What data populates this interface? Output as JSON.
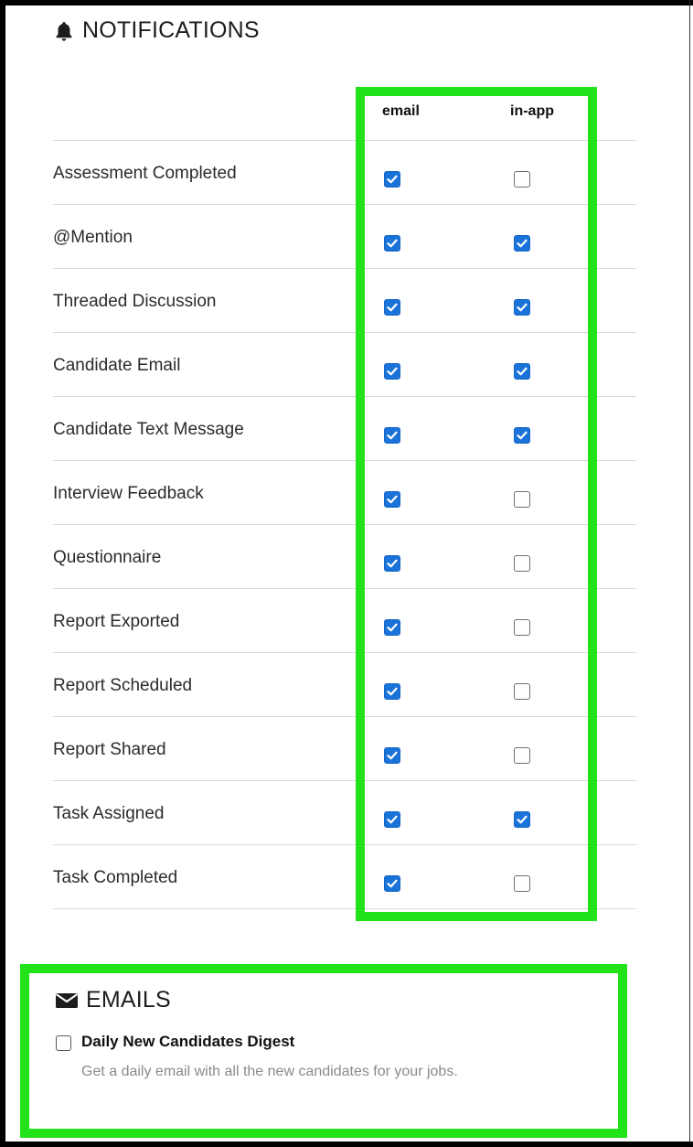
{
  "notifications": {
    "title": "NOTIFICATIONS",
    "icon": "bell-icon",
    "columns": [
      "email",
      "in-app"
    ],
    "rows": [
      {
        "label": "Assessment Completed",
        "email": true,
        "in_app": false
      },
      {
        "label": "@Mention",
        "email": true,
        "in_app": true
      },
      {
        "label": "Threaded Discussion",
        "email": true,
        "in_app": true
      },
      {
        "label": "Candidate Email",
        "email": true,
        "in_app": true
      },
      {
        "label": "Candidate Text Message",
        "email": true,
        "in_app": true
      },
      {
        "label": "Interview Feedback",
        "email": true,
        "in_app": false
      },
      {
        "label": "Questionnaire",
        "email": true,
        "in_app": false
      },
      {
        "label": "Report Exported",
        "email": true,
        "in_app": false
      },
      {
        "label": "Report Scheduled",
        "email": true,
        "in_app": false
      },
      {
        "label": "Report Shared",
        "email": true,
        "in_app": false
      },
      {
        "label": "Task Assigned",
        "email": true,
        "in_app": true
      },
      {
        "label": "Task Completed",
        "email": true,
        "in_app": false
      }
    ]
  },
  "emails": {
    "title": "EMAILS",
    "icon": "envelope-icon",
    "digest": {
      "label": "Daily New Candidates Digest",
      "description": "Get a daily email with all the new candidates for your jobs.",
      "checked": false
    }
  },
  "colors": {
    "highlight": "#22e31a",
    "checkbox_checked": "#1a73d9",
    "frame": "#000000"
  }
}
